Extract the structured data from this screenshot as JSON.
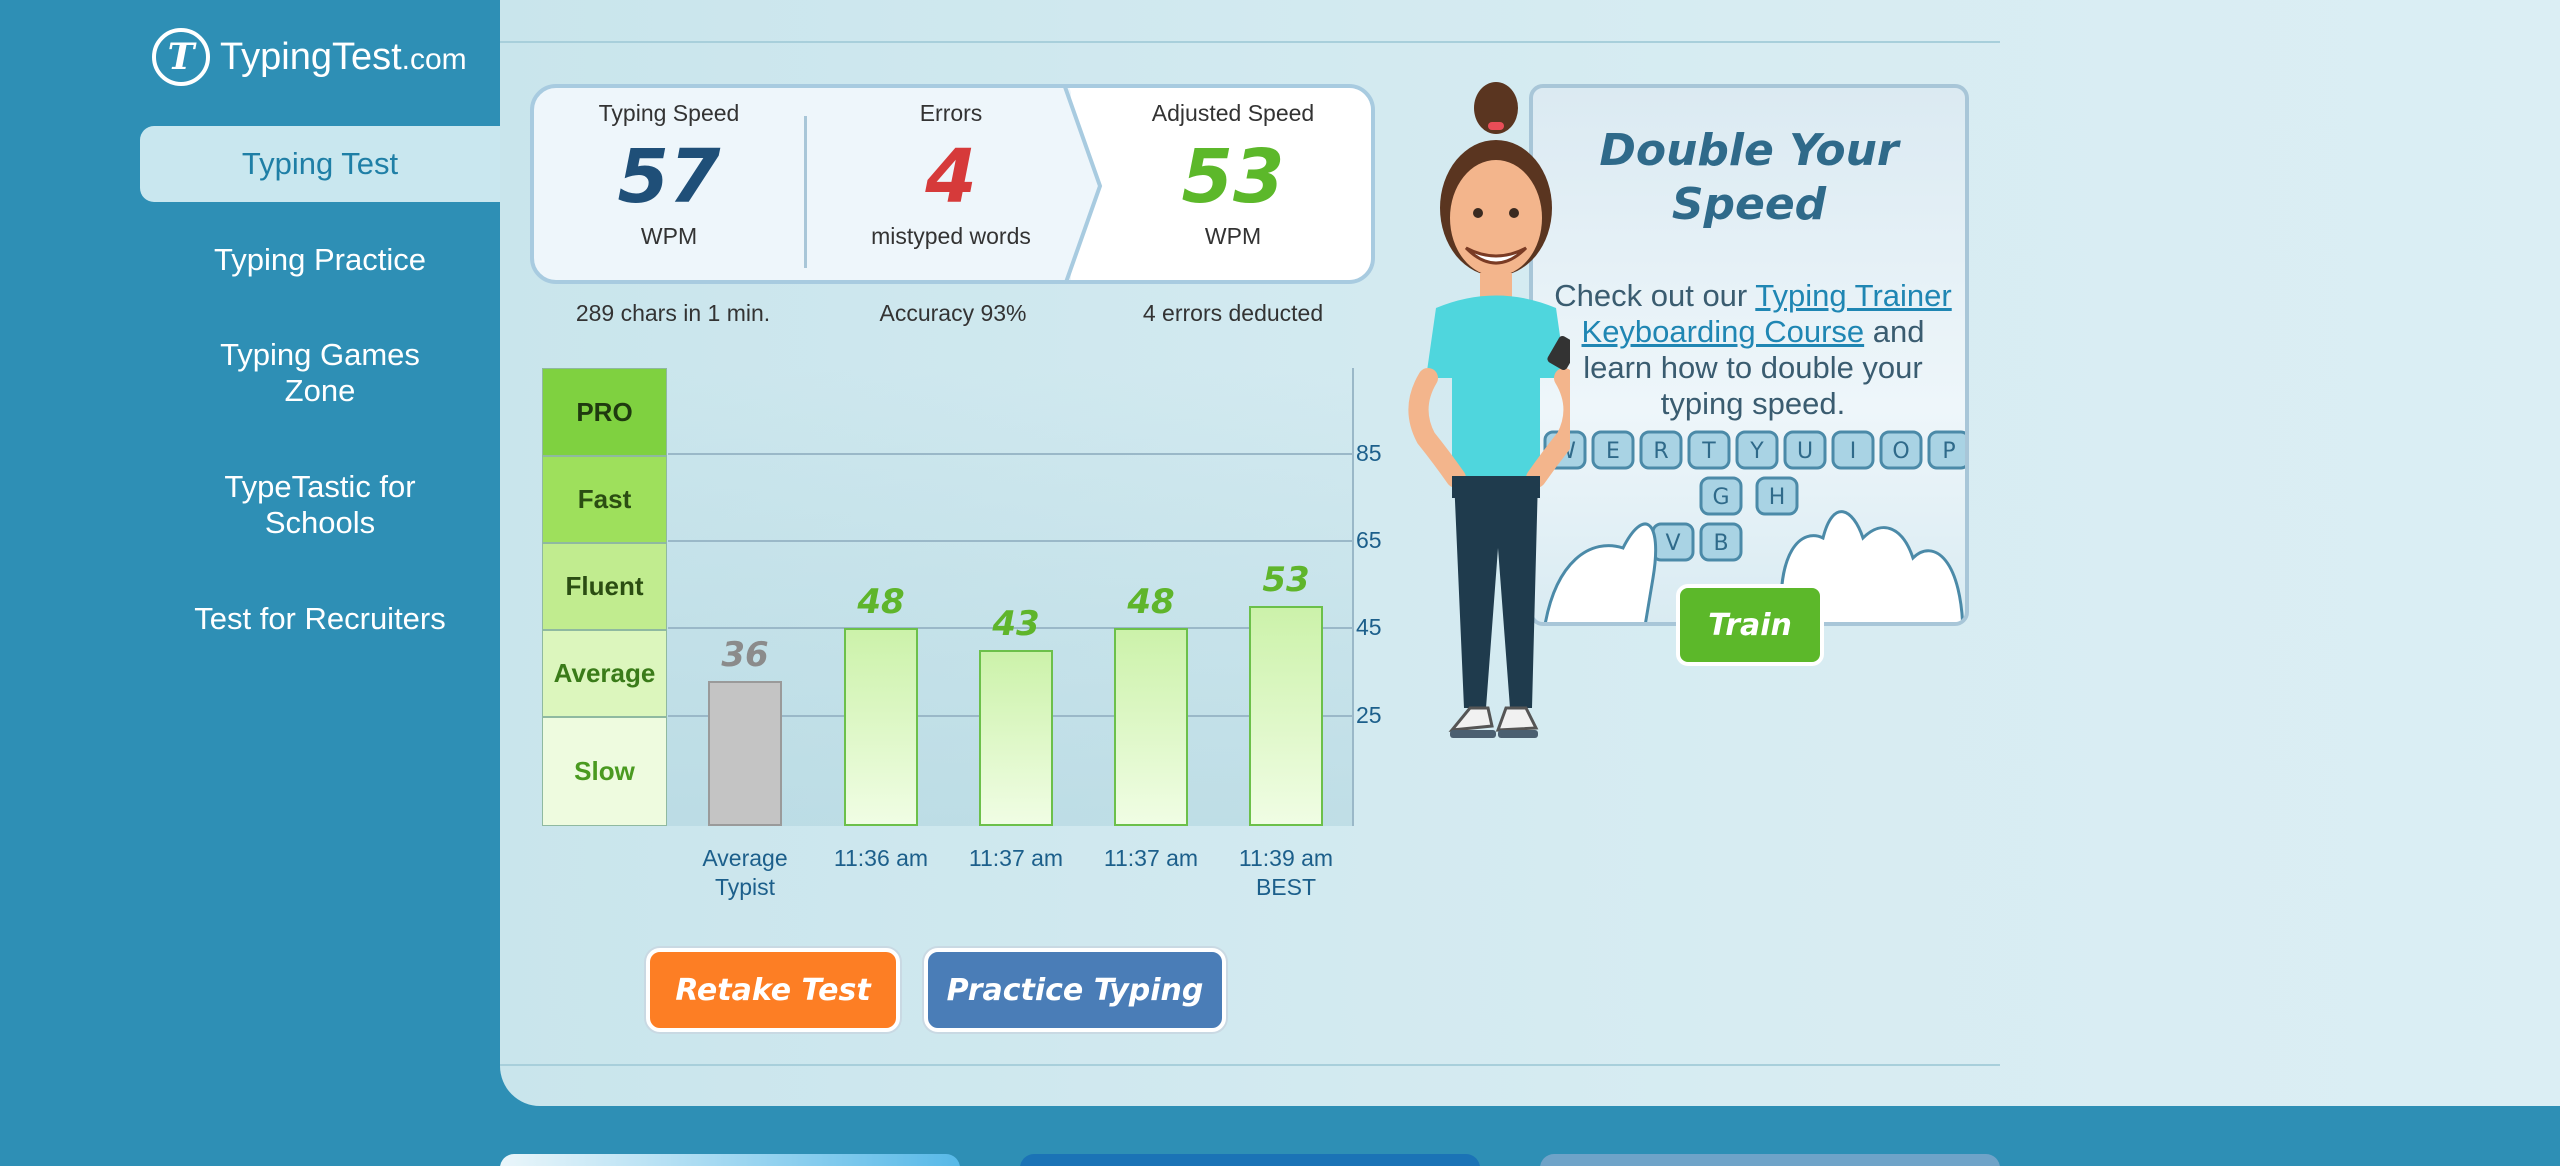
{
  "brand": {
    "logo_letter": "T",
    "name": "TypingTest",
    "tld": ".com"
  },
  "sidebar": {
    "items": [
      {
        "label": "Typing Test",
        "active": true
      },
      {
        "label": "Typing Practice"
      },
      {
        "label": "Typing Games Zone"
      },
      {
        "label": "TypeTastic for Schools"
      },
      {
        "label": "Test for Recruiters"
      }
    ]
  },
  "results": {
    "speed": {
      "label": "Typing Speed",
      "value": "57",
      "unit": "WPM",
      "sub": "289 chars in 1 min."
    },
    "errors": {
      "label": "Errors",
      "value": "4",
      "unit": "mistyped words",
      "sub": "Accuracy 93%"
    },
    "adjusted": {
      "label": "Adjusted Speed",
      "value": "53",
      "unit": "WPM",
      "sub": "4 errors deducted"
    }
  },
  "tiers": [
    "PRO",
    "Fast",
    "Fluent",
    "Average",
    "Slow"
  ],
  "chart_data": {
    "type": "bar",
    "categories": [
      "Average Typist",
      "11:36 am",
      "11:37 am",
      "11:37 am",
      "11:39 am BEST"
    ],
    "values": [
      36,
      48,
      43,
      48,
      53
    ],
    "y_ticks": [
      "85",
      "65",
      "45",
      "25"
    ],
    "ylim": [
      0,
      90
    ]
  },
  "x_labels": [
    [
      "Average",
      "Typist"
    ],
    [
      "11:36 am",
      ""
    ],
    [
      "11:37 am",
      ""
    ],
    [
      "11:37 am",
      ""
    ],
    [
      "11:39 am",
      "BEST"
    ]
  ],
  "bar_labels": [
    "36",
    "48",
    "43",
    "48",
    "53"
  ],
  "buttons": {
    "retake": "Retake Test",
    "practice": "Practice Typing"
  },
  "promo": {
    "title_line1": "Double Your",
    "title_line2": "Speed",
    "text_pre": "Check out our ",
    "link": "Typing Trainer Keyboarding Course",
    "text_post": " and learn how to double your typing speed.",
    "keys_row1": [
      "W",
      "E",
      "R",
      "T",
      "Y",
      "U",
      "I",
      "O",
      "P"
    ],
    "keys_row2": [
      "G",
      "H"
    ],
    "keys_row3": [
      "V",
      "B"
    ],
    "train": "Train"
  },
  "colors": {
    "orange": "#fd7e24",
    "blue": "#4a7db7",
    "green": "#5cb82a",
    "red": "#d63a3a",
    "navy": "#1f4f78"
  }
}
